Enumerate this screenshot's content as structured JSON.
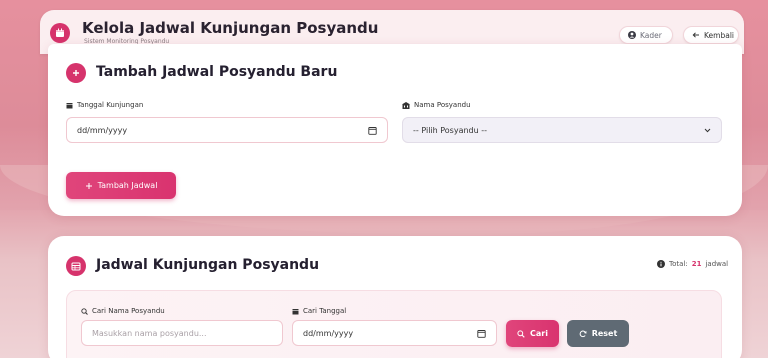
{
  "header": {
    "title": "Kelola Jadwal Kunjungan Posyandu",
    "subtitle": "Sistem Monitoring Posyandu",
    "user_label": "Kader",
    "back_label": "Kembali"
  },
  "form": {
    "title": "Tambah Jadwal Posyandu Baru",
    "date_label": "Tanggal Kunjungan",
    "date_value": "dd/mm/yyyy",
    "posyandu_label": "Nama Posyandu",
    "posyandu_value": "-- Pilih Posyandu --",
    "submit_label": "Tambah Jadwal"
  },
  "schedule": {
    "title": "Jadwal Kunjungan Posyandu",
    "total_prefix": "Total:",
    "total_count": "21",
    "total_suffix": "jadwal",
    "search_name_label": "Cari Nama Posyandu",
    "search_name_placeholder": "Masukkan nama posyandu...",
    "search_date_label": "Cari Tanggal",
    "search_date_value": "dd/mm/yyyy",
    "search_button": "Cari",
    "reset_button": "Reset"
  },
  "colors": {
    "accent": "#d6336c",
    "secondary": "#5f6a74"
  },
  "icons": [
    "calendar-icon",
    "plus-icon",
    "building-icon",
    "user-circle-icon",
    "arrow-left-icon",
    "table-icon",
    "info-icon",
    "search-icon",
    "refresh-icon"
  ]
}
